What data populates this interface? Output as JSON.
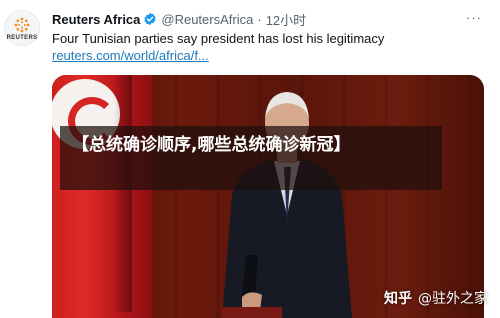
{
  "tweet": {
    "avatar_text": "REUTERS",
    "author_name": "Reuters Africa",
    "handle": "@ReutersAfrica",
    "separator": "·",
    "time": "12小时",
    "more": "···",
    "text": "Four Tunisian parties say president has lost his legitimacy",
    "link": "reuters.com/world/africa/f..."
  },
  "media": {
    "overlay_text": "【总统确诊顺序,哪些总统确诊新冠】",
    "watermark_brand": "知乎",
    "watermark_user": "@驻外之家"
  },
  "colors": {
    "verified": "#1d9bf0",
    "link": "#1d7bbd",
    "flag_red": "#e02a26"
  },
  "icons": [
    "verified-badge-icon",
    "reuters-logo-icon",
    "more-options-icon"
  ]
}
